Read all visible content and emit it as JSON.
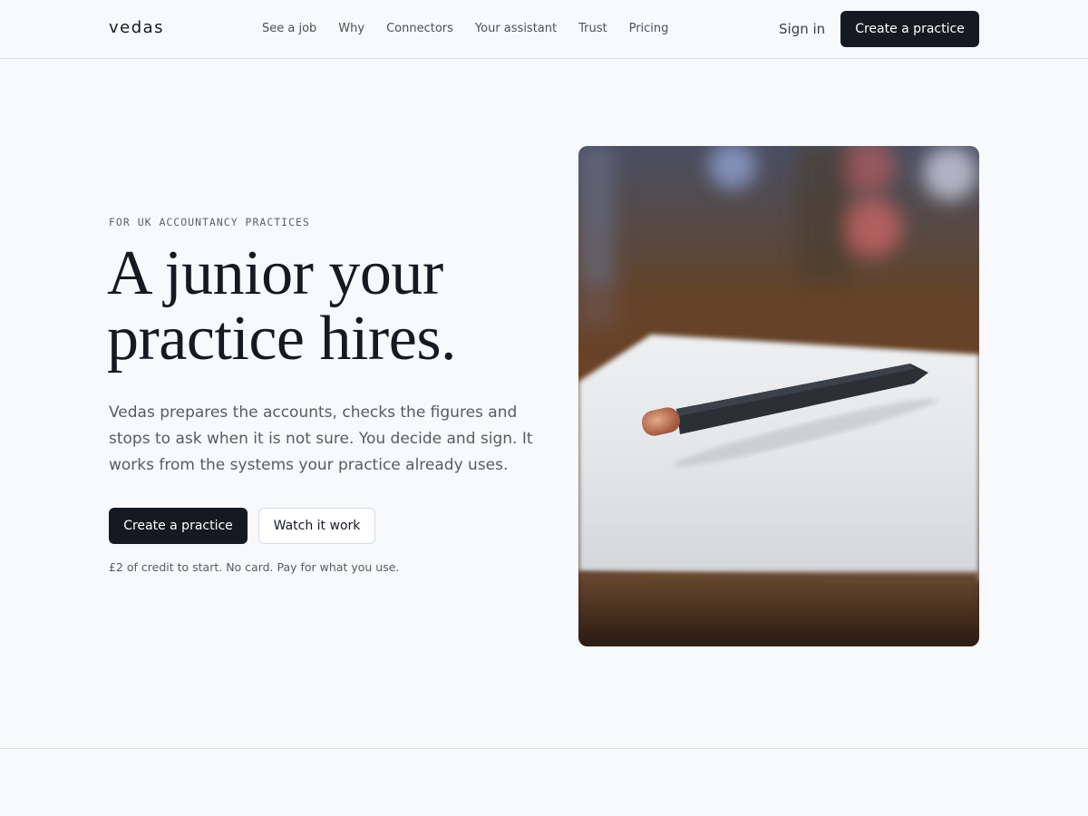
{
  "header": {
    "logo": "vedas",
    "nav": [
      "See a job",
      "Why",
      "Connectors",
      "Your assistant",
      "Trust",
      "Pricing"
    ],
    "sign_in": "Sign in",
    "cta": "Create a practice"
  },
  "hero": {
    "eyebrow": "FOR UK ACCOUNTANCY PRACTICES",
    "headline_line1": "A junior your",
    "headline_line2": "practice hires.",
    "lede": "Vedas prepares the accounts, checks the figures and stops to ask when it is not sure. You decide and sign. It works from the systems your practice already uses.",
    "primary_cta": "Create a practice",
    "secondary_cta": "Watch it work",
    "note": "£2 of credit to start. No card. Pay for what you use."
  },
  "colors": {
    "background": "#f7f9fc",
    "ink": "#151a22",
    "muted": "#555c66",
    "border": "#dfe3e9"
  }
}
